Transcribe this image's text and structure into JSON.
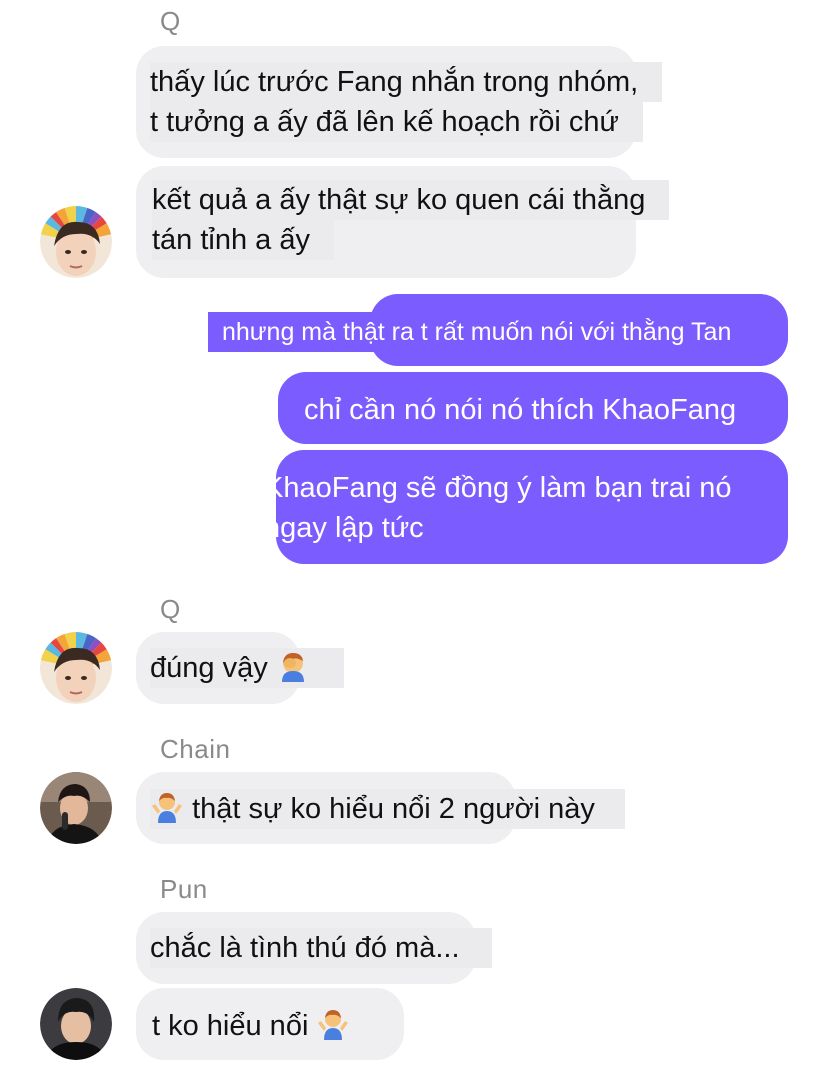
{
  "messages": [
    {
      "sender": "Q"
    },
    {
      "line1": "thấy lúc trước Fang nhắn trong nhóm,",
      "line2": "t tưởng a ấy đã lên kế hoạch rồi chứ"
    },
    {
      "line1": "kết quả a ấy thật sự ko quen cái thằng",
      "line2": "tán tỉnh a ấy"
    },
    {
      "text": "nhưng mà thật ra t rất muốn nói với thằng Tan"
    },
    {
      "text": "chỉ cần nó nói nó thích KhaoFang"
    },
    {
      "line1": "KhaoFang sẽ đồng ý làm bạn trai nó",
      "line2": "ngay lập tức"
    },
    {
      "sender": "Q"
    },
    {
      "text": "đúng vậy",
      "emoji": "facepalm-emoji"
    },
    {
      "sender": "Chain"
    },
    {
      "text": "thật sự ko hiểu nổi 2 người này",
      "emoji": "shrug-emoji"
    },
    {
      "sender": "Pun"
    },
    {
      "text": "chắc là tình thú đó mà..."
    },
    {
      "text": "t ko hiểu nổi",
      "emoji": "shrug-emoji"
    }
  ],
  "colors": {
    "outgoing_bubble": "#7a5cff",
    "incoming_bubble": "#efeff1",
    "sender_name": "#8a8a8a"
  }
}
